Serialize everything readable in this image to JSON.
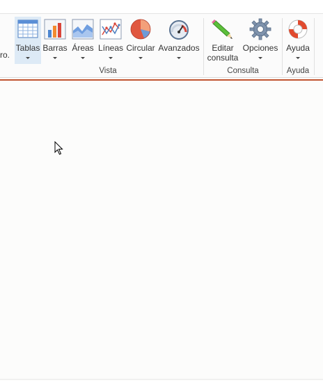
{
  "ribbon": {
    "truncated_left_text": "ro.",
    "buttons": [
      {
        "label": "Tablas",
        "icon": "table-icon",
        "dropdown": true,
        "selected": true
      },
      {
        "label": "Barras",
        "icon": "bar-chart-icon",
        "dropdown": true
      },
      {
        "label": "Áreas",
        "icon": "area-chart-icon",
        "dropdown": true
      },
      {
        "label": "Líneas",
        "icon": "line-chart-icon",
        "dropdown": true
      },
      {
        "label": "Circular",
        "icon": "pie-chart-icon",
        "dropdown": true
      },
      {
        "label": "Avanzados",
        "icon": "gauge-icon",
        "dropdown": true
      },
      {
        "label": "Editar consulta",
        "label_line1": "Editar",
        "label_line2": "consulta",
        "icon": "pencil-icon",
        "dropdown": false
      },
      {
        "label": "Opciones",
        "icon": "gear-icon",
        "dropdown": true
      },
      {
        "label": "Ayuda",
        "icon": "lifebuoy-icon",
        "dropdown": true
      }
    ],
    "groups": [
      {
        "label": "Vista"
      },
      {
        "label": "Consulta"
      },
      {
        "label": "Ayuda"
      }
    ]
  },
  "colors": {
    "accent": "#c0532f",
    "selected_bg": "#ddeaf6",
    "canvas_bg": "#fcfcfb"
  }
}
